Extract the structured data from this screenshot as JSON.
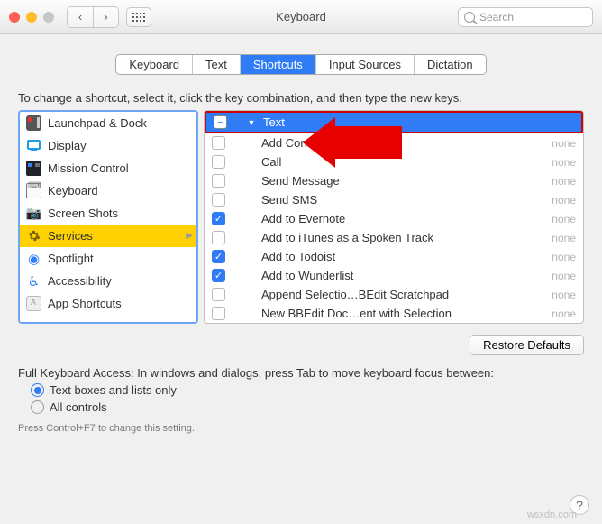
{
  "window": {
    "title": "Keyboard",
    "search_placeholder": "Search"
  },
  "tabs": [
    {
      "label": "Keyboard"
    },
    {
      "label": "Text"
    },
    {
      "label": "Shortcuts",
      "active": true
    },
    {
      "label": "Input Sources"
    },
    {
      "label": "Dictation"
    }
  ],
  "instructions": "To change a shortcut, select it, click the key combination, and then type the new keys.",
  "categories": [
    {
      "label": "Launchpad & Dock",
      "icon": "launchpad"
    },
    {
      "label": "Display",
      "icon": "display"
    },
    {
      "label": "Mission Control",
      "icon": "mission"
    },
    {
      "label": "Keyboard",
      "icon": "keyboard"
    },
    {
      "label": "Screen Shots",
      "icon": "screenshot"
    },
    {
      "label": "Services",
      "icon": "services",
      "selected": true
    },
    {
      "label": "Spotlight",
      "icon": "spotlight"
    },
    {
      "label": "Accessibility",
      "icon": "access"
    },
    {
      "label": "App Shortcuts",
      "icon": "appshort"
    }
  ],
  "services": {
    "group_label": "Text",
    "group_state": "mixed",
    "items": [
      {
        "label": "Add Contact",
        "checked": false,
        "shortcut": "none"
      },
      {
        "label": "Call",
        "checked": false,
        "shortcut": "none"
      },
      {
        "label": "Send Message",
        "checked": false,
        "shortcut": "none"
      },
      {
        "label": "Send SMS",
        "checked": false,
        "shortcut": "none"
      },
      {
        "label": "Add to Evernote",
        "checked": true,
        "shortcut": "none"
      },
      {
        "label": "Add to iTunes as a Spoken Track",
        "checked": false,
        "shortcut": "none"
      },
      {
        "label": "Add to Todoist",
        "checked": true,
        "shortcut": "none"
      },
      {
        "label": "Add to Wunderlist",
        "checked": true,
        "shortcut": "none"
      },
      {
        "label": "Append Selectio…BEdit Scratchpad",
        "checked": false,
        "shortcut": "none"
      },
      {
        "label": "New BBEdit Doc…ent with Selection",
        "checked": false,
        "shortcut": "none"
      }
    ]
  },
  "restore_label": "Restore Defaults",
  "fka": {
    "intro": "Full Keyboard Access: In windows and dialogs, press Tab to move keyboard focus between:",
    "opt1": "Text boxes and lists only",
    "opt2": "All controls",
    "hint": "Press Control+F7 to change this setting."
  },
  "help_label": "?",
  "watermark": "wsxdn.com"
}
